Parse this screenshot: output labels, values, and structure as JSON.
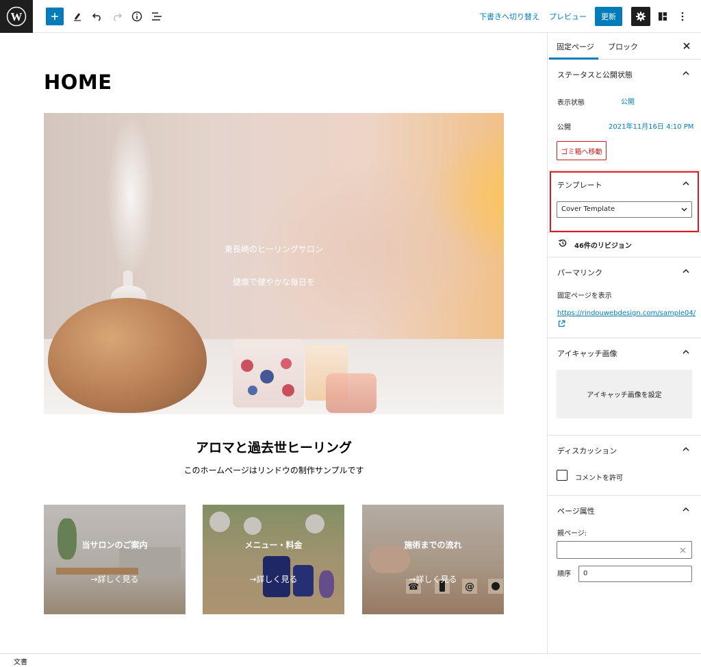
{
  "toolbar": {
    "switch_to_draft": "下書きへ切り替え",
    "preview": "プレビュー",
    "update": "更新"
  },
  "editor": {
    "page_title": "HOME",
    "cover": {
      "line1": "東長崎のヒーリングサロン",
      "line2": "健康で健やかな毎日を"
    },
    "heading": "アロマと過去世ヒーリング",
    "subheading": "このホームページはリンドウの制作サンプルです",
    "cards": [
      {
        "title": "当サロンのご案内",
        "link": "→詳しく見る"
      },
      {
        "title": "メニュー・料金",
        "link": "→詳しく見る"
      },
      {
        "title": "施術までの流れ",
        "link": "→詳しく見る"
      }
    ]
  },
  "footer": {
    "breadcrumb": "文書"
  },
  "sidebar": {
    "tabs": [
      "固定ページ",
      "ブロック"
    ],
    "status_panel": {
      "title": "ステータスと公開状態",
      "visibility_label": "表示状態",
      "visibility_value": "公開",
      "publish_label": "公開",
      "publish_value": "2021年11月16日 4:10 PM",
      "trash_button": "ゴミ箱へ移動"
    },
    "template_panel": {
      "title": "テンプレート",
      "selected": "Cover Template"
    },
    "revisions": "46件のリビジョン",
    "permalink_panel": {
      "title": "パーマリンク",
      "view_label": "固定ページを表示",
      "url": "https://rindouwebdesign.com/sample04/"
    },
    "featured_panel": {
      "title": "アイキャッチ画像",
      "set_button": "アイキャッチ画像を設定"
    },
    "discussion_panel": {
      "title": "ディスカッション",
      "allow_comments": "コメントを許可"
    },
    "attributes_panel": {
      "title": "ページ属性",
      "parent_label": "親ページ:",
      "parent_value": "",
      "order_label": "順序",
      "order_value": "0"
    }
  },
  "colors": {
    "accent": "#007cba",
    "danger": "#cc1818",
    "highlight": "#e2171e",
    "dark": "#1e1e1e"
  }
}
